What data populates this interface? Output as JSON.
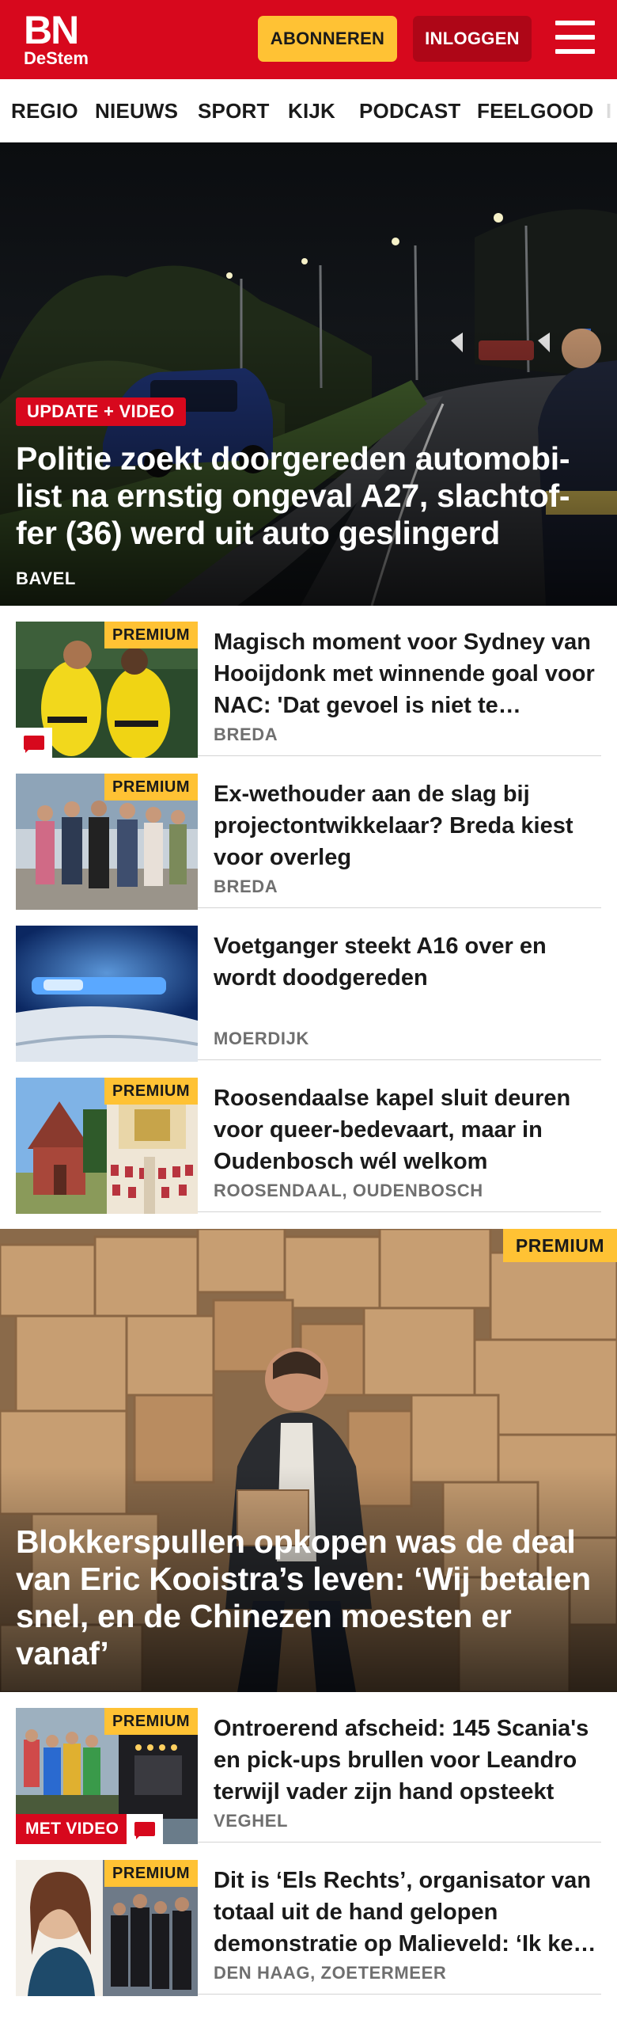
{
  "header": {
    "logo_main": "BN",
    "logo_sub": "DeStem",
    "subscribe_label": "ABONNEREN",
    "login_label": "INLOGGEN",
    "menu_icon": "hamburger-menu-icon",
    "brand_color": "#d7081d",
    "accent_color": "#ffc234"
  },
  "nav": {
    "items": [
      "REGIO",
      "NIEUWS",
      "SPORT",
      "KIJK",
      "PODCAST",
      "FEELGOOD"
    ]
  },
  "hero": {
    "badge": "UPDATE + VIDEO",
    "title": "Politie zoekt doorgereden automobi-list na ernstig ongeval A27, slachtof-fer (36) werd uit auto geslingerd",
    "location": "BAVEL"
  },
  "articles_top": [
    {
      "premium": "PREMIUM",
      "title": "Magisch moment voor Sydney van Hooijdonk met winnende goal voor NAC: 'Dat gevoel is niet te beschrijven'",
      "location": "BREDA",
      "comments_icon": "comment-icon"
    },
    {
      "premium": "PREMIUM",
      "title": "Ex-wethouder aan de slag bij projectontwikkelaar? Breda kiest voor overleg",
      "location": "BREDA"
    },
    {
      "premium": "",
      "title": "Voetganger steekt A16 over en wordt doodgereden",
      "location": "MOERDIJK"
    },
    {
      "premium": "PREMIUM",
      "title": "Roosendaalse kapel sluit deuren voor queer-bedevaart, maar in Oudenbosch wél welkom",
      "location": "ROOSENDAAL, OUDENBOSCH"
    }
  ],
  "feature": {
    "premium": "PREMIUM",
    "title": "Blokkerspullen opkopen was de deal van Eric Kooistra’s leven: ‘Wij betalen snel, en de Chinezen moesten er vanaf’"
  },
  "articles_bottom": [
    {
      "premium": "PREMIUM",
      "video_badge": "MET VIDEO",
      "title": "Ontroerend afscheid: 145 Scania's en pick-ups brullen voor Leandro terwijl vader zijn hand opsteekt",
      "location": "VEGHEL",
      "comments_icon": "comment-icon"
    },
    {
      "premium": "PREMIUM",
      "title": "Dit is ‘Els Rechts’, organisator van totaal uit de hand gelopen demonstratie op Malieveld: ‘Ik keur geweld af’",
      "location": "DEN HAAG, ZOETERMEER"
    }
  ]
}
